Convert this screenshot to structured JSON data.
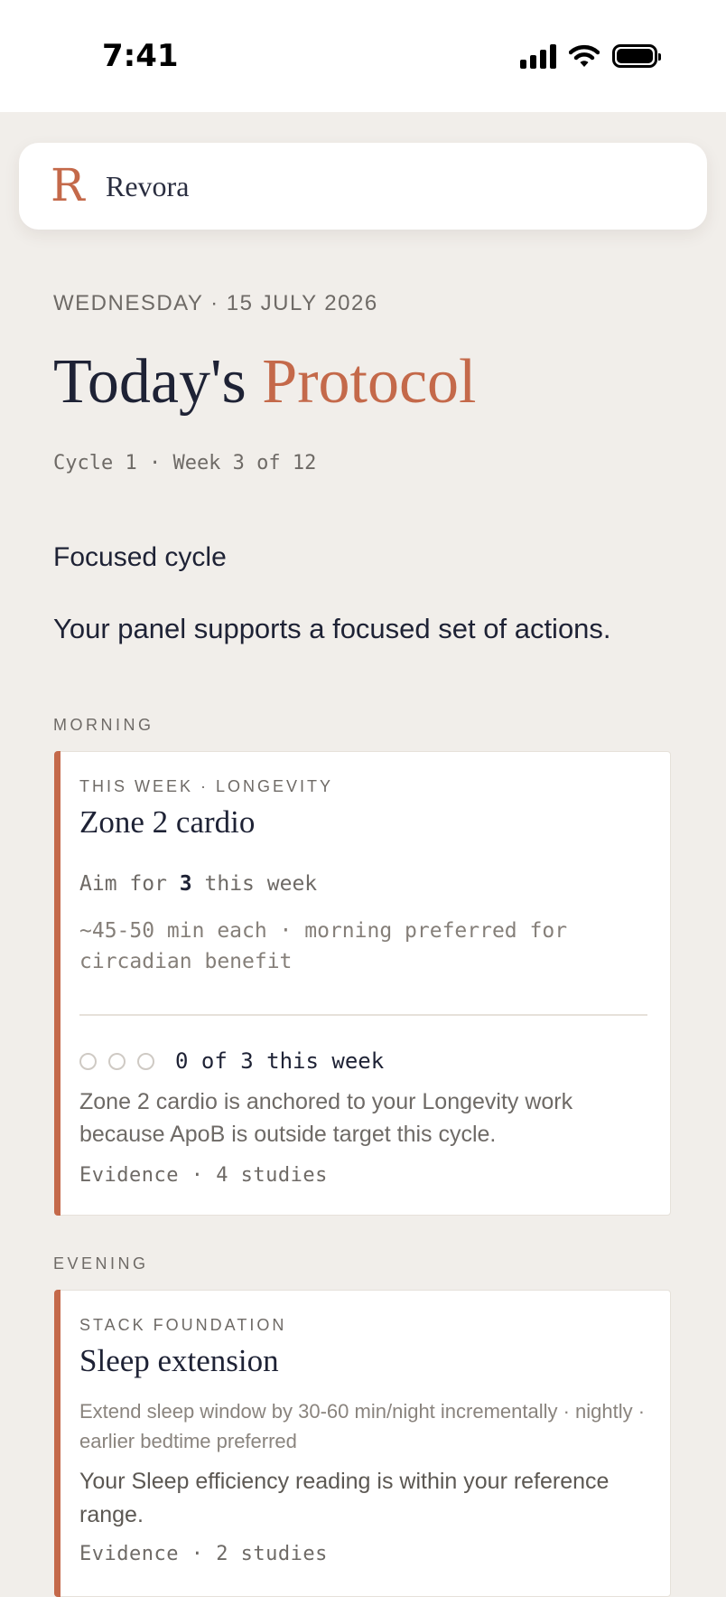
{
  "status_bar": {
    "time": "7:41",
    "icons": [
      "signal-icon",
      "wifi-icon",
      "battery-icon"
    ]
  },
  "brand": {
    "logo_letter": "R",
    "name": "Revora"
  },
  "header": {
    "date": "WEDNESDAY · 15 JULY 2026",
    "title_main": "Today's",
    "title_accent": "Protocol",
    "cycle": "Cycle 1 · Week 3 of 12"
  },
  "focus": {
    "heading": "Focused cycle",
    "description": "Your panel supports a focused set of actions."
  },
  "sections": {
    "morning": {
      "label": "MORNING",
      "card": {
        "eyebrow": "THIS WEEK · LONGEVITY",
        "title": "Zone 2 cardio",
        "aim_prefix": "Aim for",
        "aim_count": "3",
        "aim_suffix": "this week",
        "detail": "~45-50 min each · morning preferred for circadian benefit",
        "progress_text": "0 of 3 this week",
        "progress": {
          "done": 0,
          "total": 3
        },
        "body": "Zone 2 cardio is anchored to your Longevity work because ApoB is outside target this cycle.",
        "evidence": "Evidence · 4 studies"
      }
    },
    "evening": {
      "label": "EVENING",
      "card": {
        "eyebrow": "STACK FOUNDATION",
        "title": "Sleep extension",
        "detail": "Extend sleep window by 30-60 min/night incrementally · nightly · earlier bedtime preferred",
        "body": "Your Sleep efficiency reading is within your reference range.",
        "evidence": "Evidence · 2 studies"
      }
    }
  },
  "colors": {
    "accent": "#C4694A",
    "background": "#F1EEEA",
    "ink": "#1E2235"
  }
}
